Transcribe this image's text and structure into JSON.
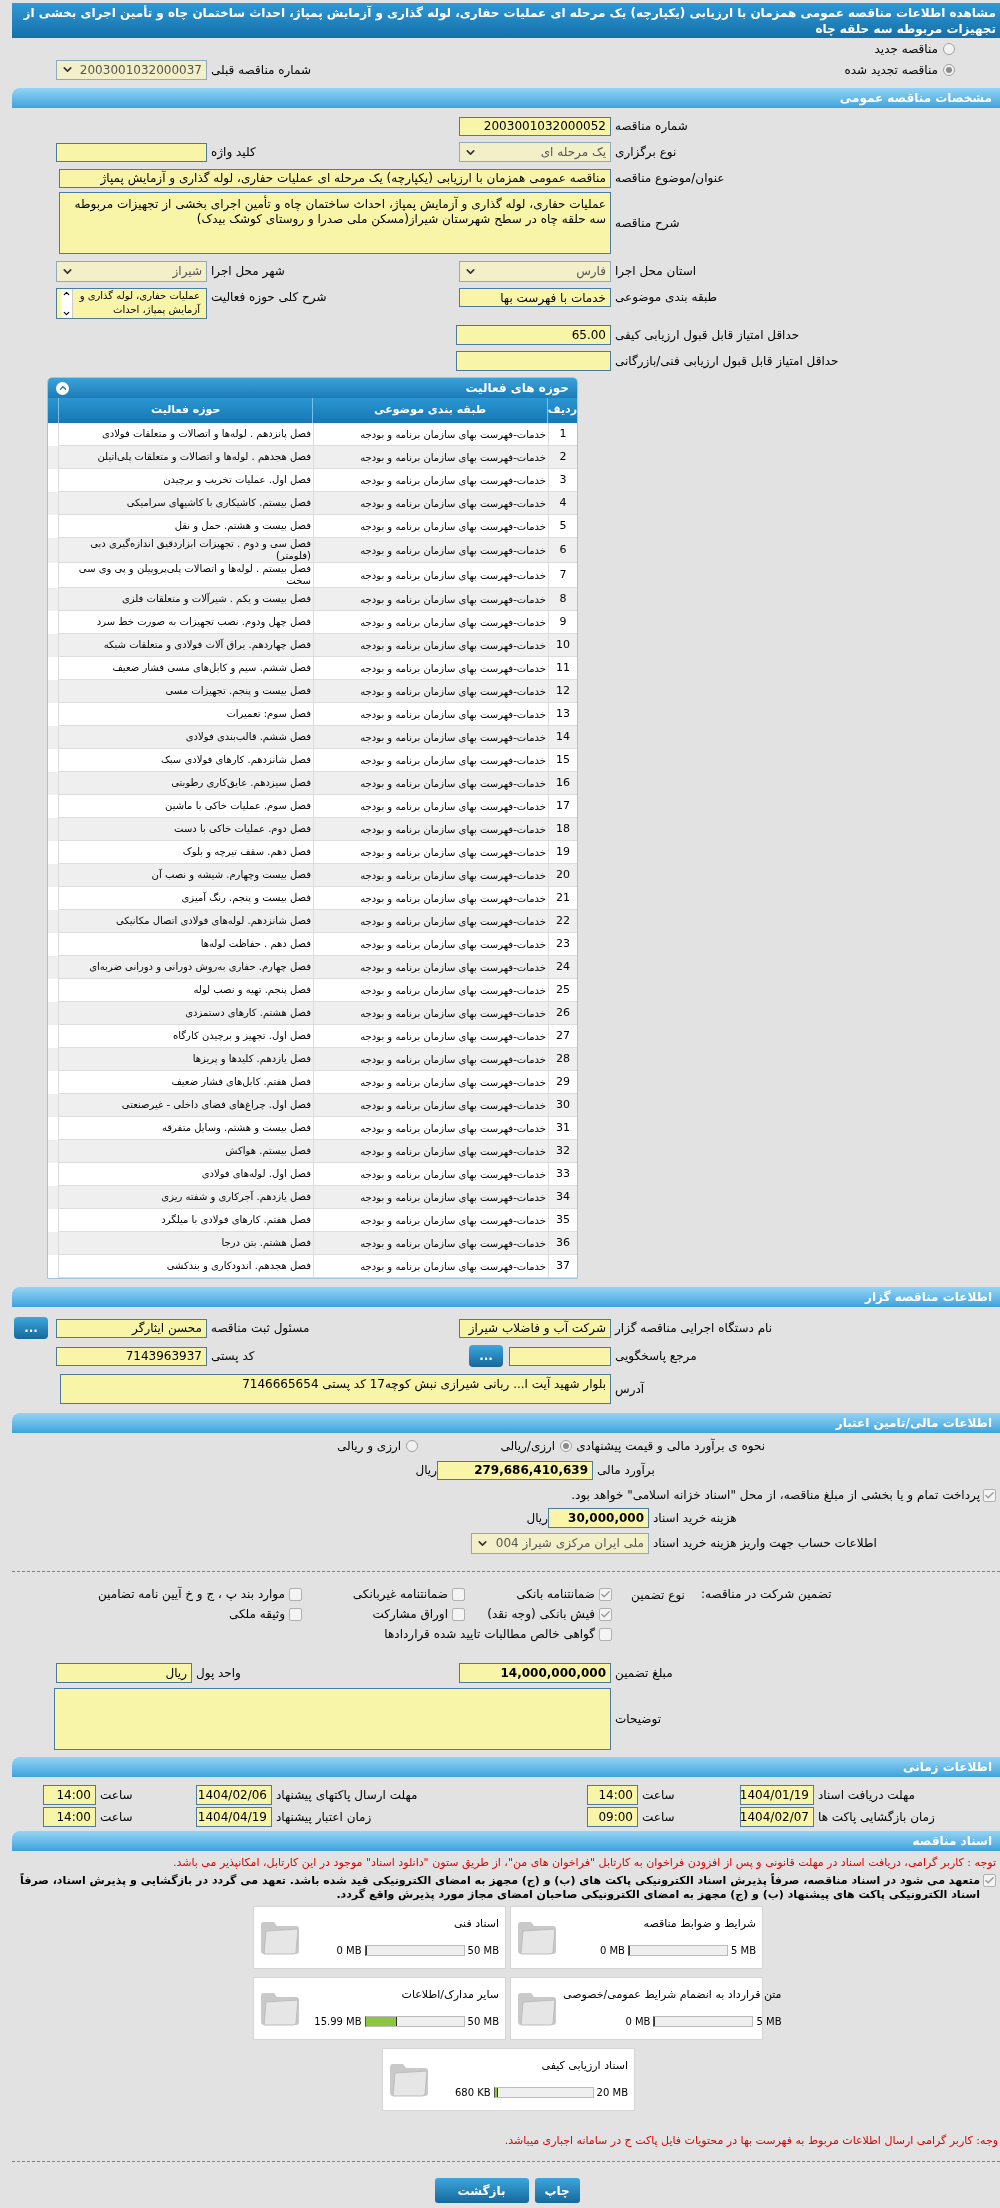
{
  "page_title": "مشاهده اطلاعات مناقصه عمومی همزمان با ارزیابی (یکپارچه) یک مرحله ای عملیات حفاری، لوله گذاری و آزمایش پمپاژ، احداث ساختمان چاه و تأمین اجرای بخشی از تجهیزات مربوطه سه حلقه چاه",
  "tender_kind": [
    {
      "label": "مناقصه جدید",
      "selected": false
    },
    {
      "label": "مناقصه تجدید شده",
      "selected": true
    }
  ],
  "previous_tender": {
    "label": "شماره مناقصه قبلی",
    "value": "2003001032000037"
  },
  "general": {
    "title": "مشخصات مناقصه عمومی",
    "tender_number": {
      "label": "شماره مناقصه",
      "value": "2003001032000052"
    },
    "holding_type": {
      "label": "نوع برگزاری",
      "value": "یک مرحله ای"
    },
    "keyword": {
      "label": "کلید واژه"
    },
    "subject": {
      "label": "عنوان/موضوع مناقصه",
      "value": "مناقصه عمومی همزمان با ارزیابی (یکپارچه) یک مرحله ای عملیات حفاری، لوله گذاری و آزمایش پمپاژ"
    },
    "description": {
      "label": "شرح مناقصه",
      "value": "عملیات حفاری، لوله گذاری و آزمایش پمپاژ، احداث ساختمان چاه و تأمین اجرای بخشی از تجهیزات مربوطه سه حلقه چاه در سطح شهرستان شیراز(مسکن ملی صدرا و روستای کوشک بیدک)"
    },
    "province": {
      "label": "استان محل اجرا",
      "value": "فارس"
    },
    "city": {
      "label": "شهر محل اجرا",
      "value": "شیراز"
    },
    "classification": {
      "label": "طبقه بندی موضوعی",
      "value": "خدمات با فهرست بها"
    },
    "activity_summary": {
      "label": "شرح کلی حوزه فعالیت",
      "value": "عملیات حفاری، لوله گذاری و آزمایش پمپاژ، احداث"
    },
    "min_quality_score": {
      "label": "حداقل امتیاز قابل قبول ارزیابی کیفی",
      "value": "65.00"
    },
    "min_technical_score": {
      "label": "حداقل امتیاز قابل قبول ارزیابی فنی/بازرگانی"
    }
  },
  "activities": {
    "title": "حوزه های فعالیت",
    "columns": [
      "ردیف",
      "طبقه بندی موضوعی",
      "حوزه فعالیت"
    ],
    "rows": [
      {
        "index": "1",
        "category": "خدمات-فهرست بهای سازمان برنامه و بودجه",
        "activity": "فصل پانزدهم . لوله‌ها و اتصالات و متعلقات فولادی"
      },
      {
        "index": "2",
        "category": "خدمات-فهرست بهای سازمان برنامه و بودجه",
        "activity": "فصل هجدهم . لوله‌ها و اتصالات و متعلقات  پلی‌اتیلن"
      },
      {
        "index": "3",
        "category": "خدمات-فهرست بهای سازمان برنامه و بودجه",
        "activity": "فصل اول. عملیات تخریب و برچیدن"
      },
      {
        "index": "4",
        "category": "خدمات-فهرست بهای سازمان برنامه و بودجه",
        "activity": "فصل بیستم. کاشیکاری با کاشیهای سرامیکی"
      },
      {
        "index": "5",
        "category": "خدمات-فهرست بهای سازمان برنامه و بودجه",
        "activity": "فصل بیست و هشتم. حمل و نقل"
      },
      {
        "index": "6",
        "category": "خدمات-فهرست بهای سازمان برنامه و بودجه",
        "activity": "فصل سی و دوم . تجهیزات ابزاردقیق اندازه‌گیری دبی (فلومتر)"
      },
      {
        "index": "7",
        "category": "خدمات-فهرست بهای سازمان برنامه و بودجه",
        "activity": "فصل بیستم . لوله‌ها و اتصالات پلی‌پروپیلن و پی وی سی سخت"
      },
      {
        "index": "8",
        "category": "خدمات-فهرست بهای سازمان برنامه و بودجه",
        "activity": "فصل بیست و یکم . شیرآلات و متعلقات فلزی"
      },
      {
        "index": "9",
        "category": "خدمات-فهرست بهای سازمان برنامه و بودجه",
        "activity": "فصل چهل ودوم. نصب تجهیزات به صورت خط سرد"
      },
      {
        "index": "10",
        "category": "خدمات-فهرست بهای سازمان برنامه و بودجه",
        "activity": "فصل چهاردهم. یراق آلات فولادی و متعلقات شبکه"
      },
      {
        "index": "11",
        "category": "خدمات-فهرست بهای سازمان برنامه و بودجه",
        "activity": "فصل ششم. سیم و کابل‌های مسی فشار ضعیف"
      },
      {
        "index": "12",
        "category": "خدمات-فهرست بهای سازمان برنامه و بودجه",
        "activity": "فصل بیست و پنجم. تجهیزات مسی"
      },
      {
        "index": "13",
        "category": "خدمات-فهرست بهای سازمان برنامه و بودجه",
        "activity": "فصل سوم: تعمیرات"
      },
      {
        "index": "14",
        "category": "خدمات-فهرست بهای سازمان برنامه و بودجه",
        "activity": "فصل ششم. قالب‌بندی فولادی"
      },
      {
        "index": "15",
        "category": "خدمات-فهرست بهای سازمان برنامه و بودجه",
        "activity": "فصل شانزدهم. کارهای فولادی سبک"
      },
      {
        "index": "16",
        "category": "خدمات-فهرست بهای سازمان برنامه و بودجه",
        "activity": "فصل سیزدهم. عایق‌کاری رطوبتی"
      },
      {
        "index": "17",
        "category": "خدمات-فهرست بهای سازمان برنامه و بودجه",
        "activity": "فصل سوم. عملیات خاکی با ماشین"
      },
      {
        "index": "18",
        "category": "خدمات-فهرست بهای سازمان برنامه و بودجه",
        "activity": "فصل دوم. عملیات خاکی با دست"
      },
      {
        "index": "19",
        "category": "خدمات-فهرست بهای سازمان برنامه و بودجه",
        "activity": "فصل دهم. سقف تیرچه و بلوک"
      },
      {
        "index": "20",
        "category": "خدمات-فهرست بهای سازمان برنامه و بودجه",
        "activity": "فصل بیست وچهارم. شیشه و نصب آن"
      },
      {
        "index": "21",
        "category": "خدمات-فهرست بهای سازمان برنامه و بودجه",
        "activity": "فصل بیست و پنجم. رنگ آمیزی"
      },
      {
        "index": "22",
        "category": "خدمات-فهرست بهای سازمان برنامه و بودجه",
        "activity": "فصل شانزدهم. لوله‌های فولادی اتصال مکانیکی"
      },
      {
        "index": "23",
        "category": "خدمات-فهرست بهای سازمان برنامه و بودجه",
        "activity": "فصل دهم . حفاظت لوله‌ها"
      },
      {
        "index": "24",
        "category": "خدمات-فهرست بهای سازمان برنامه و بودجه",
        "activity": "فصل چهارم. حفاری به‌روش دورانی و دورانی ضربه‌ای"
      },
      {
        "index": "25",
        "category": "خدمات-فهرست بهای سازمان برنامه و بودجه",
        "activity": "فصل پنجم. تهیه و نصب لوله"
      },
      {
        "index": "26",
        "category": "خدمات-فهرست بهای سازمان برنامه و بودجه",
        "activity": "فصل هشتم. کارهای دستمزدی"
      },
      {
        "index": "27",
        "category": "خدمات-فهرست بهای سازمان برنامه و بودجه",
        "activity": "فصل اول. تجهیز و برچیدن کارگاه"
      },
      {
        "index": "28",
        "category": "خدمات-فهرست بهای سازمان برنامه و بودجه",
        "activity": "فصل یازدهم. کلیدها و پریزها"
      },
      {
        "index": "29",
        "category": "خدمات-فهرست بهای سازمان برنامه و بودجه",
        "activity": "فصل هفتم. کابل‌های فشار ضعیف"
      },
      {
        "index": "30",
        "category": "خدمات-فهرست بهای سازمان برنامه و بودجه",
        "activity": "فصل اول. چراغ‌های فضای داخلی - غیرصنعتی"
      },
      {
        "index": "31",
        "category": "خدمات-فهرست بهای سازمان برنامه و بودجه",
        "activity": "فصل بیست و هشتم. وسایل متفرقه"
      },
      {
        "index": "32",
        "category": "خدمات-فهرست بهای سازمان برنامه و بودجه",
        "activity": "فصل بیستم. هواکش"
      },
      {
        "index": "33",
        "category": "خدمات-فهرست بهای سازمان برنامه و بودجه",
        "activity": "فصل اول. لوله‌های فولادی"
      },
      {
        "index": "34",
        "category": "خدمات-فهرست بهای سازمان برنامه و بودجه",
        "activity": "فصل یازدهم. آجرکاری و شفته ریزی"
      },
      {
        "index": "35",
        "category": "خدمات-فهرست بهای سازمان برنامه و بودجه",
        "activity": "فصل هفتم. کارهای فولادی با میلگرد"
      },
      {
        "index": "36",
        "category": "خدمات-فهرست بهای سازمان برنامه و بودجه",
        "activity": "فصل هشتم. بتن درجا"
      },
      {
        "index": "37",
        "category": "خدمات-فهرست بهای سازمان برنامه و بودجه",
        "activity": "فصل هجدهم. اندودکاری و بندکشی"
      }
    ]
  },
  "organizer": {
    "title": "اطلاعات مناقصه گزار",
    "agency": {
      "label": "نام دستگاه اجرایی مناقصه گزار",
      "value": "شرکت آب و فاضلاب شیراز"
    },
    "registrar": {
      "label": "مسئول ثبت مناقصه",
      "value": "محسن ایثارگر",
      "button": "..."
    },
    "reference": {
      "label": "مرجع پاسخگویی",
      "button": "..."
    },
    "postal_code": {
      "label": "کد پستی",
      "value": "7143963937"
    },
    "address": {
      "label": "آدرس",
      "value": "بلوار شهید آیت ا... ربانی شیرازی نبش کوچه17 کد پستی 7146665654"
    }
  },
  "finance": {
    "title": "اطلاعات مالی/تامین اعتبار",
    "estimate_method": {
      "label": "نحوه ی برآورد مالی و قیمت پیشنهادی",
      "options": [
        {
          "label": "ارزی/ریالی",
          "selected": true
        },
        {
          "label": "ارزی و ریالی",
          "selected": false
        }
      ]
    },
    "estimate": {
      "label": "برآورد مالی",
      "value": "279,686,410,639",
      "unit": "ریال"
    },
    "treasury": {
      "label": "پرداخت تمام و یا بخشی از مبلغ مناقصه، از محل \"اسناد خزانه اسلامی\" خواهد بود.",
      "checked": true
    },
    "document_fee": {
      "label": "هزینه خرید اسناد",
      "value": "30,000,000",
      "unit": "ریال"
    },
    "account": {
      "label": "اطلاعات حساب جهت واریز هزینه خرید اسناد",
      "value": "ملی ایران مرکزی شیراز 004"
    }
  },
  "guarantee": {
    "title": "تضمین شرکت در مناقصه:",
    "type_label": "نوع تضمین",
    "options": [
      {
        "label": "ضمانتنامه بانکی",
        "checked": true
      },
      {
        "label": "ضمانتنامه غیربانکی",
        "checked": false
      },
      {
        "label": "موارد بند پ ، ج و خ آیین نامه تضامین",
        "checked": false
      },
      {
        "label": "فیش بانکی (وجه نقد)",
        "checked": true
      },
      {
        "label": "اوراق مشارکت",
        "checked": false
      },
      {
        "label": "وثیقه ملکی",
        "checked": false
      },
      {
        "label": "گواهی خالص مطالبات تایید شده قراردادها",
        "checked": false
      }
    ],
    "amount": {
      "label": "مبلغ تضمین",
      "value": "14,000,000,000"
    },
    "currency": {
      "label": "واحد پول",
      "value": "ریال"
    },
    "notes": {
      "label": "توضیحات"
    }
  },
  "timing": {
    "title": "اطلاعات زمانی",
    "items": [
      {
        "label": "مهلت دریافت اسناد",
        "date": "1404/01/19",
        "time_label": "ساعت",
        "time": "14:00"
      },
      {
        "label": "مهلت ارسال پاکتهای پیشنهاد",
        "date": "1404/02/06",
        "time_label": "ساعت",
        "time": "14:00"
      },
      {
        "label": "زمان بازگشایی پاکت ها",
        "date": "1404/02/07",
        "time_label": "ساعت",
        "time": "09:00"
      },
      {
        "label": "زمان اعتبار پیشنهاد",
        "date": "1404/04/19",
        "time_label": "ساعت",
        "time": "14:00"
      }
    ]
  },
  "documents": {
    "title": "اسناد مناقصه",
    "notice": "توجه : کاربر گرامی، دریافت اسناد در مهلت قانونی و پس از افزودن فراخوان به کارتابل \"فراخوان های من\"، از طریق ستون \"دانلود اسناد\" موجود در این کارتابل، امکانپذیر می باشد.",
    "commitment": {
      "checked": true,
      "text": "متعهد می شود در اسناد مناقصه، صرفاً پذیرش اسناد الکترونیکی پاکت های (ب) و (ج) مجهز به امضای الکترونیکی قید شده باشد. تعهد می گردد در بازگشایی و پذیرش اسناد، صرفاً اسناد الکترونیکی پاکت های پیشنهاد (ب) و (ج) مجهز به امضای الکترونیکی صاحبان امضای مجاز مورد پذیرش واقع گردد."
    },
    "files": [
      {
        "name": "شرایط و ضوابط مناقصه",
        "used": "0 MB",
        "max": "5 MB",
        "level": 0
      },
      {
        "name": "اسناد فنی",
        "used": "0 MB",
        "max": "50 MB",
        "level": 0
      },
      {
        "name": "متن قرارداد به انضمام شرایط عمومی/خصوصی",
        "used": "0 MB",
        "max": "5 MB",
        "level": 0
      },
      {
        "name": "سایر مدارک/اطلاعات",
        "used": "15.99 MB",
        "max": "50 MB",
        "level": 0.32
      },
      {
        "name": "اسناد ارزیابی کیفی",
        "used": "680 KB",
        "max": "20 MB",
        "level": 0.034
      }
    ],
    "footer_notice": "وجه: کاربر گرامی ارسال اطلاعات مربوط به فهرست بها در محتویات فایل پاکت ج در سامانه اجباری میباشد."
  },
  "buttons": [
    {
      "label": "چاپ"
    },
    {
      "label": "بازگشت"
    }
  ]
}
